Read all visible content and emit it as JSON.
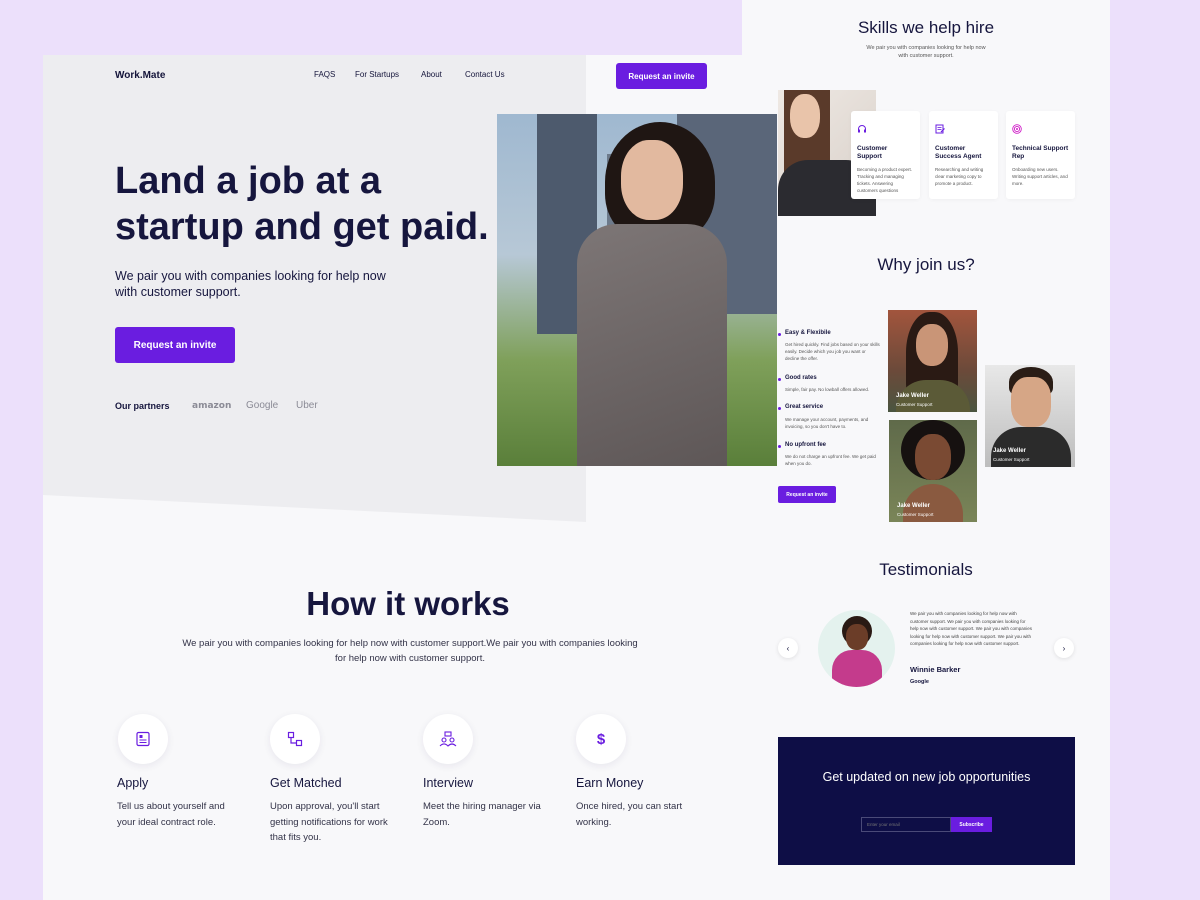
{
  "brand": "Work.Mate",
  "nav": {
    "links": [
      "FAQS",
      "For Startups",
      "About",
      "Contact Us"
    ],
    "cta": "Request an invite"
  },
  "hero": {
    "title": "Land a job at a startup and get paid.",
    "subtitle": "We pair you with companies looking for help now with customer support.",
    "cta": "Request an invite",
    "partners_label": "Our partners",
    "partners": [
      "amazon",
      "Google",
      "Uber"
    ]
  },
  "how": {
    "title": "How it works",
    "subtitle": "We pair you with companies looking for help now with customer support.We pair you with companies looking for help now with customer support.",
    "steps": [
      {
        "title": "Apply",
        "desc": "Tell us about yourself and your ideal contract role.",
        "icon": "document-icon"
      },
      {
        "title": "Get Matched",
        "desc": "Upon approval, you'll start getting notifications for work that fits you.",
        "icon": "match-icon"
      },
      {
        "title": "Interview",
        "desc": "Meet the hiring manager via Zoom.",
        "icon": "interview-icon"
      },
      {
        "title": "Earn Money",
        "desc": "Once hired, you can start working.",
        "icon": "dollar-icon"
      }
    ]
  },
  "skills": {
    "title": "Skills we help hire",
    "subtitle": "We pair you with companies looking for help now with customer support.",
    "cards": [
      {
        "title": "Customer Support",
        "desc": "Becoming a product expert. Tracking and managing tickets. Answering customers questions",
        "icon": "headset-icon"
      },
      {
        "title": "Customer Success Agent",
        "desc": "Researching and writing clear marketing copy to promote a product.",
        "icon": "edit-icon"
      },
      {
        "title": "Technical Support Rep",
        "desc": "Onboarding new users. Writing support articles, and more.",
        "icon": "target-icon"
      }
    ]
  },
  "why": {
    "title": "Why join us?",
    "benefits": [
      {
        "title": "Easy & Flexibile",
        "desc": "Get hired quickly. Find jobs based on your skills easily. Decide which you job you want or decline the offer."
      },
      {
        "title": "Good rates",
        "desc": "Simple, fair pay. No lowball offers allowed."
      },
      {
        "title": "Great service",
        "desc": "We manage your account, payments, and invoicing, so you don't have to."
      },
      {
        "title": "No upfront fee",
        "desc": "We do not charge an upfront fee. We get paid when you do."
      }
    ],
    "cta": "Request an invite",
    "people": [
      {
        "name": "Jake Weller",
        "role": "Customer Support"
      },
      {
        "name": "Jake Weller",
        "role": "Customer Support"
      },
      {
        "name": "Jake Weller",
        "role": "Customer Support"
      }
    ]
  },
  "testimonials": {
    "title": "Testimonials",
    "quote": "We pair you with companies looking for help now with customer support. We pair you with companies looking for help now with customer support. We pair you with companies looking for help now with customer support. We pair you with companies looking for help now with customer support.",
    "name": "Winnie Barker",
    "company": "Google",
    "prev": "‹",
    "next": "›"
  },
  "newsletter": {
    "title": "Get updated on new job opportunities",
    "placeholder": "Enter your email",
    "button": "Subscribe"
  },
  "colors": {
    "accent": "#6a1de0",
    "navy": "#0e0e46",
    "background": "#ece0fb"
  }
}
